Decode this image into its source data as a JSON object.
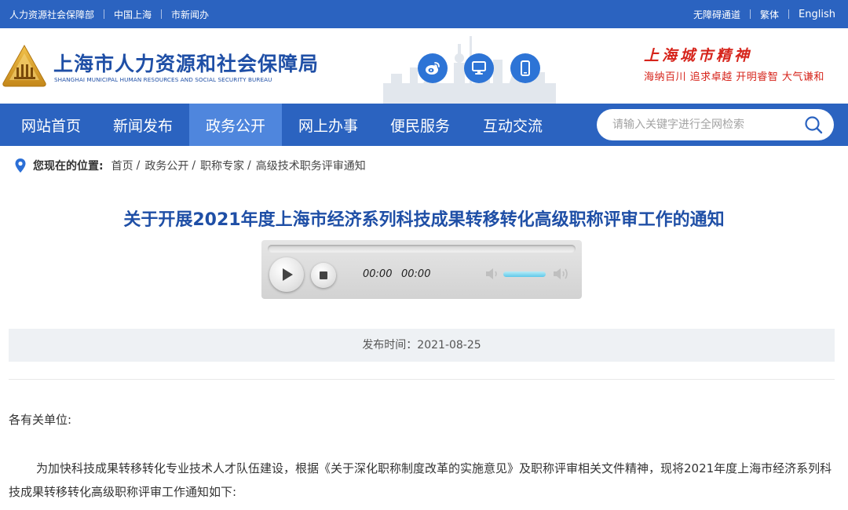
{
  "topbar": {
    "links": [
      "人力资源社会保障部",
      "中国上海",
      "市新闻办"
    ],
    "accessibility": "无障碍通道",
    "traditional": "繁体",
    "english": "English"
  },
  "header": {
    "site_name": "上海市人力资源和社会保障局",
    "site_name_en": "SHANGHAI MUNICIPAL HUMAN RESOURCES AND SOCIAL SECURITY BUREAU",
    "icons": [
      "weibo-icon",
      "computer-icon",
      "mobile-icon"
    ],
    "spirit_title": "上海城市精神",
    "spirit_words": "海纳百川  追求卓越  开明睿智  大气谦和"
  },
  "nav": {
    "items": [
      "网站首页",
      "新闻发布",
      "政务公开",
      "网上办事",
      "便民服务",
      "互动交流"
    ],
    "active": "政务公开"
  },
  "search": {
    "placeholder": "请输入关键字进行全网检索"
  },
  "breadcrumb": {
    "label": "您现在的位置:",
    "items": [
      "首页",
      "政务公开",
      "职称专家",
      "高级技术职务评审通知"
    ]
  },
  "article": {
    "title": "关于开展2021年度上海市经济系列科技成果转移转化高级职称评审工作的通知",
    "publish_time": "发布时间：2021-08-25",
    "greeting": "各有关单位:",
    "paragraph": "为加快科技成果转移转化专业技术人才队伍建设，根据《关于深化职称制度改革的实施意见》及职称评审相关文件精神，现将2021年度上海市经济系列科技成果转移转化高级职称评审工作通知如下:"
  },
  "player": {
    "current_time": "00:00",
    "duration": "00:00",
    "volume": 0.8
  },
  "colors": {
    "primary": "#2b63c0",
    "nav_active": "#4f86dd",
    "title": "#1f4fa6",
    "spirit": "#d6241b"
  }
}
